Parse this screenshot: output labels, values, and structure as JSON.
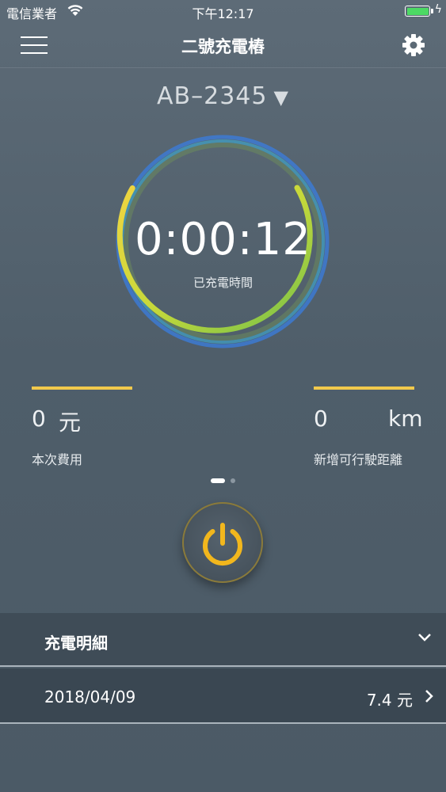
{
  "status_bar": {
    "carrier": "電信業者",
    "time": "下午12:17",
    "icons": [
      "wifi-icon",
      "battery-icon",
      "charging-bolt-icon"
    ]
  },
  "nav": {
    "title": "二號充電樁",
    "menu_icon": "hamburger-menu-icon",
    "settings_icon": "gear-icon"
  },
  "station": {
    "id": "AB–2345",
    "arrow": "▼"
  },
  "timer": {
    "value": "0:00:12",
    "label": "已充電時間"
  },
  "stats": {
    "cost": {
      "value": "0",
      "unit": "元",
      "label": "本次費用"
    },
    "distance": {
      "value": "0",
      "unit": "km",
      "label": "新增可行駛距離"
    }
  },
  "pager": {
    "pages": 2,
    "active": 0
  },
  "power_button": {
    "icon": "power-icon",
    "accent": "#f2b71d"
  },
  "details": {
    "title": "充電明細",
    "records": [
      {
        "date": "2018/04/09",
        "amount": "7.4 元"
      }
    ]
  },
  "colors": {
    "accent_yellow": "#f2c94c",
    "ring_green": "#8dc63f",
    "ring_blue": "#2f7fd6",
    "background": "#4f5e6a"
  }
}
